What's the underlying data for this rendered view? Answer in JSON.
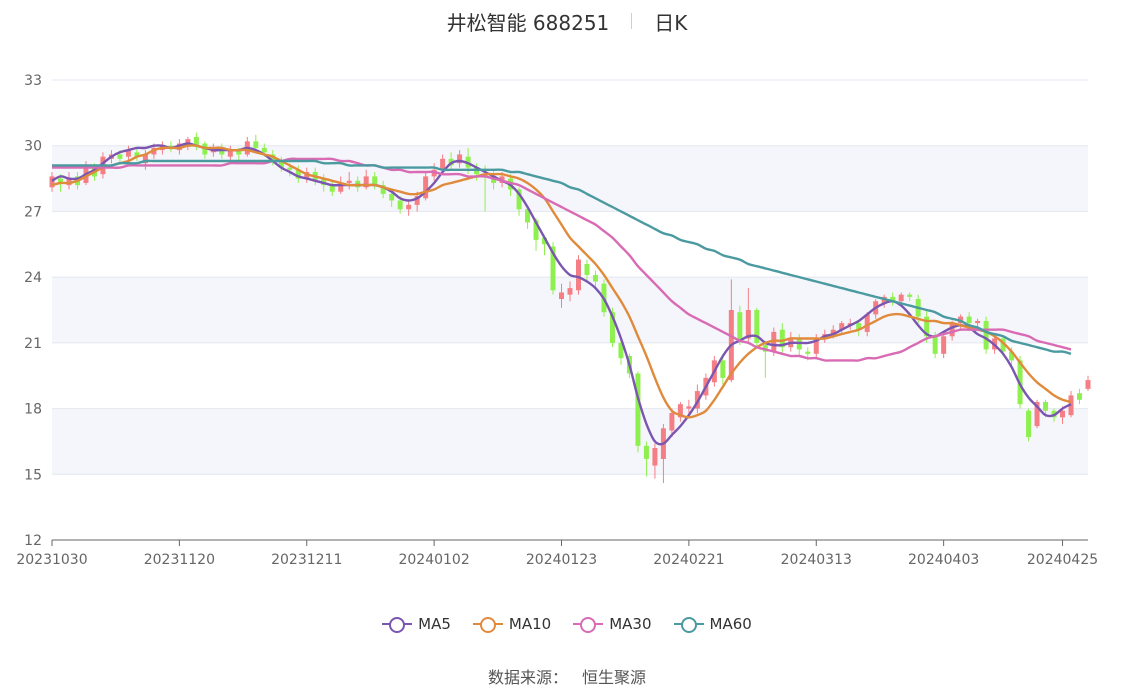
{
  "header": {
    "stock": "井松智能 688251",
    "period": "日K"
  },
  "source": {
    "label": "数据来源：",
    "value": "恒生聚源"
  },
  "colors": {
    "up": "#f57e85",
    "down": "#8ef04e",
    "grid": "#e4e7f0",
    "band": "#f5f6fb",
    "axis": "#555555"
  },
  "chart_data": {
    "type": "candlestick",
    "ylim": [
      12,
      33
    ],
    "yticks": [
      12,
      15,
      18,
      21,
      24,
      27,
      30,
      33
    ],
    "x_tick_labels": [
      "20231030",
      "20231120",
      "20231211",
      "20240102",
      "20240123",
      "20240221",
      "20240313",
      "20240403",
      "20240425"
    ],
    "x_tick_index": [
      0,
      15,
      30,
      45,
      60,
      75,
      90,
      105,
      119
    ],
    "candles": [
      [
        28.1,
        28.6,
        27.9,
        28.8
      ],
      [
        28.5,
        28.3,
        27.9,
        28.7
      ],
      [
        28.2,
        28.5,
        28.0,
        28.8
      ],
      [
        28.6,
        28.2,
        28.0,
        28.8
      ],
      [
        28.3,
        29.1,
        28.2,
        29.3
      ],
      [
        29.0,
        28.6,
        28.4,
        29.2
      ],
      [
        28.7,
        29.5,
        28.5,
        29.7
      ],
      [
        29.4,
        29.6,
        29.2,
        29.8
      ],
      [
        29.6,
        29.4,
        29.2,
        29.8
      ],
      [
        29.5,
        29.8,
        29.3,
        30.0
      ],
      [
        29.7,
        29.5,
        29.3,
        29.9
      ],
      [
        29.2,
        29.6,
        28.9,
        29.8
      ],
      [
        29.6,
        29.9,
        29.4,
        30.1
      ],
      [
        29.8,
        30.0,
        29.6,
        30.2
      ],
      [
        30.0,
        29.9,
        29.7,
        30.2
      ],
      [
        29.8,
        30.1,
        29.6,
        30.3
      ],
      [
        30.0,
        30.3,
        29.8,
        30.4
      ],
      [
        30.4,
        30.0,
        29.8,
        30.6
      ],
      [
        30.1,
        29.6,
        29.4,
        30.2
      ],
      [
        29.7,
        29.9,
        29.5,
        30.1
      ],
      [
        29.9,
        29.6,
        29.4,
        30.1
      ],
      [
        29.5,
        29.8,
        29.3,
        30.0
      ],
      [
        29.8,
        29.6,
        29.3,
        29.9
      ],
      [
        29.6,
        30.2,
        29.5,
        30.4
      ],
      [
        30.2,
        29.9,
        29.7,
        30.5
      ],
      [
        29.9,
        29.7,
        29.5,
        30.1
      ],
      [
        29.6,
        29.3,
        29.1,
        29.8
      ],
      [
        29.3,
        29.0,
        28.8,
        29.5
      ],
      [
        29.0,
        28.9,
        28.6,
        29.2
      ],
      [
        28.9,
        28.5,
        28.3,
        29.1
      ],
      [
        28.5,
        28.8,
        28.3,
        29.0
      ],
      [
        28.8,
        28.4,
        28.2,
        29.0
      ],
      [
        28.5,
        28.2,
        27.9,
        28.7
      ],
      [
        28.2,
        27.9,
        27.7,
        28.4
      ],
      [
        27.9,
        28.3,
        27.8,
        28.6
      ],
      [
        28.3,
        28.4,
        28.0,
        28.8
      ],
      [
        28.4,
        28.1,
        27.9,
        28.6
      ],
      [
        28.1,
        28.6,
        28.0,
        28.9
      ],
      [
        28.6,
        28.2,
        28.0,
        28.8
      ],
      [
        28.2,
        27.8,
        27.6,
        28.4
      ],
      [
        27.8,
        27.5,
        27.2,
        28.0
      ],
      [
        27.5,
        27.1,
        26.9,
        27.7
      ],
      [
        27.1,
        27.3,
        26.8,
        27.5
      ],
      [
        27.3,
        27.7,
        27.0,
        27.9
      ],
      [
        27.6,
        28.6,
        27.5,
        28.8
      ],
      [
        28.6,
        28.9,
        28.4,
        29.2
      ],
      [
        28.9,
        29.4,
        28.7,
        29.6
      ],
      [
        29.4,
        29.1,
        28.9,
        29.7
      ],
      [
        29.2,
        29.6,
        29.0,
        29.8
      ],
      [
        29.5,
        29.0,
        28.7,
        29.9
      ],
      [
        29.0,
        28.7,
        28.4,
        29.2
      ],
      [
        28.7,
        28.6,
        27.0,
        29.1
      ],
      [
        28.6,
        28.3,
        28.0,
        28.9
      ],
      [
        28.3,
        28.6,
        28.1,
        28.8
      ],
      [
        28.5,
        28.0,
        27.7,
        28.7
      ],
      [
        28.0,
        27.1,
        26.8,
        28.1
      ],
      [
        27.1,
        26.5,
        26.2,
        27.2
      ],
      [
        26.6,
        25.7,
        25.2,
        26.7
      ],
      [
        25.8,
        25.5,
        25.0,
        25.9
      ],
      [
        25.4,
        23.4,
        23.2,
        25.6
      ],
      [
        23.0,
        23.3,
        22.6,
        23.7
      ],
      [
        23.2,
        23.5,
        22.9,
        23.8
      ],
      [
        23.4,
        24.8,
        23.2,
        25.0
      ],
      [
        24.6,
        24.1,
        23.8,
        24.8
      ],
      [
        24.1,
        23.8,
        23.5,
        24.3
      ],
      [
        23.7,
        22.4,
        22.2,
        23.9
      ],
      [
        22.4,
        21.0,
        20.8,
        22.6
      ],
      [
        21.0,
        20.3,
        20.0,
        21.2
      ],
      [
        20.4,
        19.6,
        19.4,
        20.5
      ],
      [
        19.6,
        16.3,
        16.0,
        19.7
      ],
      [
        16.3,
        15.7,
        14.9,
        16.5
      ],
      [
        15.4,
        16.2,
        14.8,
        16.4
      ],
      [
        15.7,
        17.1,
        14.6,
        17.3
      ],
      [
        17.0,
        17.8,
        16.7,
        18.0
      ],
      [
        17.6,
        18.2,
        17.4,
        18.3
      ],
      [
        18.0,
        18.1,
        17.6,
        18.4
      ],
      [
        18.0,
        18.8,
        17.8,
        19.1
      ],
      [
        18.6,
        19.4,
        18.4,
        19.6
      ],
      [
        19.2,
        20.2,
        19.0,
        20.4
      ],
      [
        20.2,
        19.4,
        19.1,
        20.5
      ],
      [
        19.3,
        22.5,
        19.2,
        23.9
      ],
      [
        22.4,
        21.1,
        20.9,
        22.7
      ],
      [
        21.2,
        22.5,
        21.0,
        23.5
      ],
      [
        22.5,
        21.0,
        20.8,
        22.6
      ],
      [
        20.9,
        20.6,
        19.4,
        21.1
      ],
      [
        20.6,
        21.5,
        20.4,
        21.7
      ],
      [
        21.6,
        20.8,
        20.5,
        21.9
      ],
      [
        20.8,
        21.2,
        20.6,
        21.5
      ],
      [
        21.2,
        20.7,
        20.4,
        21.4
      ],
      [
        20.6,
        20.5,
        20.2,
        20.8
      ],
      [
        20.5,
        21.2,
        20.3,
        21.4
      ],
      [
        21.2,
        21.4,
        21.0,
        21.6
      ],
      [
        21.4,
        21.6,
        21.2,
        21.8
      ],
      [
        21.6,
        21.9,
        21.4,
        22.0
      ],
      [
        21.8,
        21.9,
        21.6,
        22.1
      ],
      [
        21.9,
        21.6,
        21.3,
        22.0
      ],
      [
        21.5,
        22.3,
        21.3,
        22.4
      ],
      [
        22.3,
        22.9,
        22.1,
        23.0
      ],
      [
        22.8,
        23.1,
        22.6,
        23.2
      ],
      [
        23.1,
        22.9,
        22.7,
        23.3
      ],
      [
        22.9,
        23.2,
        22.7,
        23.3
      ],
      [
        23.2,
        23.1,
        22.9,
        23.3
      ],
      [
        23.0,
        22.2,
        21.9,
        23.2
      ],
      [
        22.2,
        21.3,
        21.0,
        22.5
      ],
      [
        21.3,
        20.5,
        20.3,
        21.5
      ],
      [
        20.5,
        21.3,
        20.3,
        21.5
      ],
      [
        21.3,
        21.9,
        21.1,
        22.0
      ],
      [
        21.9,
        22.2,
        21.6,
        22.3
      ],
      [
        22.2,
        21.9,
        21.6,
        22.4
      ],
      [
        21.9,
        22.0,
        21.7,
        22.1
      ],
      [
        22.0,
        20.7,
        20.5,
        22.2
      ],
      [
        20.7,
        21.2,
        20.5,
        21.4
      ],
      [
        21.2,
        20.6,
        20.4,
        21.3
      ],
      [
        20.6,
        20.2,
        19.9,
        20.8
      ],
      [
        20.2,
        18.2,
        18.0,
        20.4
      ],
      [
        17.9,
        16.7,
        16.5,
        18.0
      ],
      [
        17.2,
        18.3,
        17.1,
        18.4
      ],
      [
        18.3,
        17.9,
        17.6,
        18.4
      ],
      [
        17.9,
        17.6,
        17.4,
        18.0
      ],
      [
        17.6,
        17.9,
        17.3,
        18.1
      ],
      [
        17.7,
        18.6,
        17.6,
        18.8
      ],
      [
        18.7,
        18.4,
        18.2,
        18.9
      ],
      [
        18.9,
        19.3,
        18.8,
        19.5
      ]
    ],
    "series": [
      {
        "name": "MA5",
        "color": "#7a56b0",
        "values": [
          28.4,
          28.6,
          28.5,
          28.5,
          28.7,
          28.9,
          29.2,
          29.5,
          29.7,
          29.8,
          29.9,
          29.9,
          30.0,
          30.0,
          29.9,
          30.0,
          30.1,
          30.0,
          29.9,
          29.8,
          29.8,
          29.8,
          29.8,
          29.9,
          29.8,
          29.6,
          29.3,
          29.0,
          28.8,
          28.6,
          28.5,
          28.4,
          28.3,
          28.2,
          28.2,
          28.2,
          28.2,
          28.2,
          28.2,
          28.1,
          27.9,
          27.6,
          27.5,
          27.6,
          27.9,
          28.3,
          28.8,
          29.2,
          29.3,
          29.2,
          29.0,
          28.8,
          28.6,
          28.4,
          28.2,
          27.8,
          27.2,
          26.5,
          25.8,
          25.1,
          24.5,
          24.1,
          24.0,
          23.8,
          23.5,
          23.0,
          22.2,
          21.2,
          20.0,
          18.5,
          17.3,
          16.5,
          16.4,
          16.8,
          17.2,
          17.7,
          18.3,
          19.0,
          19.7,
          20.4,
          20.9,
          21.1,
          21.3,
          21.3,
          21.0,
          20.9,
          20.9,
          21.0,
          21.0,
          21.0,
          21.1,
          21.3,
          21.4,
          21.6,
          21.8,
          22.0,
          22.3,
          22.6,
          22.8,
          22.9,
          22.7,
          22.3,
          21.8,
          21.4,
          21.3,
          21.5,
          21.7,
          21.8,
          21.7,
          21.4,
          21.2,
          20.9,
          20.5,
          19.9,
          19.1,
          18.5,
          18.1,
          17.7,
          17.7,
          18.0,
          18.2
        ]
      },
      {
        "name": "MA10",
        "color": "#e08a3c",
        "values": [
          28.2,
          28.3,
          28.3,
          28.4,
          28.6,
          28.8,
          29.0,
          29.1,
          29.2,
          29.3,
          29.5,
          29.6,
          29.8,
          29.9,
          29.9,
          29.9,
          30.0,
          30.0,
          29.9,
          29.9,
          29.9,
          29.8,
          29.8,
          29.8,
          29.7,
          29.6,
          29.5,
          29.3,
          29.1,
          28.9,
          28.7,
          28.6,
          28.5,
          28.4,
          28.3,
          28.2,
          28.2,
          28.2,
          28.2,
          28.1,
          28.0,
          27.9,
          27.8,
          27.8,
          27.9,
          28.0,
          28.2,
          28.3,
          28.4,
          28.5,
          28.6,
          28.7,
          28.7,
          28.7,
          28.6,
          28.5,
          28.3,
          28.0,
          27.6,
          27.0,
          26.4,
          25.8,
          25.4,
          25.0,
          24.6,
          24.1,
          23.5,
          22.9,
          22.2,
          21.3,
          20.4,
          19.4,
          18.5,
          17.9,
          17.7,
          17.6,
          17.7,
          17.9,
          18.4,
          19.0,
          19.6,
          20.1,
          20.5,
          20.8,
          21.0,
          21.1,
          21.1,
          21.2,
          21.2,
          21.2,
          21.2,
          21.2,
          21.3,
          21.4,
          21.5,
          21.6,
          21.8,
          22.0,
          22.2,
          22.3,
          22.3,
          22.2,
          22.1,
          22.0,
          22.0,
          21.9,
          21.9,
          21.8,
          21.7,
          21.6,
          21.5,
          21.3,
          21.0,
          20.6,
          20.1,
          19.6,
          19.2,
          18.9,
          18.6,
          18.4,
          18.3
        ]
      },
      {
        "name": "MA30",
        "color": "#d86bb4",
        "values": [
          29.0,
          29.0,
          29.0,
          29.0,
          29.0,
          29.0,
          29.0,
          29.0,
          29.0,
          29.1,
          29.1,
          29.1,
          29.1,
          29.1,
          29.1,
          29.1,
          29.1,
          29.1,
          29.1,
          29.1,
          29.1,
          29.2,
          29.2,
          29.2,
          29.2,
          29.2,
          29.3,
          29.3,
          29.4,
          29.4,
          29.4,
          29.4,
          29.4,
          29.4,
          29.3,
          29.3,
          29.2,
          29.1,
          29.1,
          29.0,
          28.9,
          28.9,
          28.8,
          28.8,
          28.8,
          28.8,
          28.7,
          28.7,
          28.7,
          28.6,
          28.6,
          28.6,
          28.5,
          28.4,
          28.3,
          28.2,
          28.0,
          27.8,
          27.6,
          27.4,
          27.2,
          27.0,
          26.8,
          26.6,
          26.4,
          26.1,
          25.8,
          25.4,
          25.0,
          24.5,
          24.1,
          23.7,
          23.3,
          22.9,
          22.6,
          22.3,
          22.1,
          21.9,
          21.7,
          21.5,
          21.3,
          21.1,
          21.0,
          20.8,
          20.7,
          20.6,
          20.5,
          20.4,
          20.4,
          20.3,
          20.3,
          20.2,
          20.2,
          20.2,
          20.2,
          20.2,
          20.3,
          20.3,
          20.4,
          20.5,
          20.6,
          20.8,
          21.0,
          21.2,
          21.3,
          21.4,
          21.5,
          21.6,
          21.6,
          21.6,
          21.6,
          21.6,
          21.6,
          21.5,
          21.4,
          21.3,
          21.1,
          21.0,
          20.9,
          20.8,
          20.7
        ]
      },
      {
        "name": "MA60",
        "color": "#4a9aa0",
        "values": [
          29.1,
          29.1,
          29.1,
          29.1,
          29.1,
          29.1,
          29.1,
          29.1,
          29.2,
          29.2,
          29.2,
          29.3,
          29.3,
          29.3,
          29.3,
          29.3,
          29.3,
          29.3,
          29.3,
          29.3,
          29.3,
          29.3,
          29.3,
          29.3,
          29.3,
          29.3,
          29.3,
          29.3,
          29.3,
          29.3,
          29.3,
          29.3,
          29.2,
          29.2,
          29.2,
          29.1,
          29.1,
          29.1,
          29.1,
          29.0,
          29.0,
          29.0,
          29.0,
          29.0,
          29.0,
          29.0,
          28.9,
          28.9,
          28.9,
          28.9,
          28.9,
          28.9,
          28.9,
          28.9,
          28.8,
          28.8,
          28.7,
          28.6,
          28.5,
          28.4,
          28.3,
          28.1,
          28.0,
          27.8,
          27.6,
          27.4,
          27.2,
          27.0,
          26.8,
          26.6,
          26.4,
          26.2,
          26.0,
          25.9,
          25.7,
          25.6,
          25.5,
          25.3,
          25.2,
          25.0,
          24.9,
          24.8,
          24.6,
          24.5,
          24.4,
          24.3,
          24.2,
          24.1,
          24.0,
          23.9,
          23.8,
          23.7,
          23.6,
          23.5,
          23.4,
          23.3,
          23.2,
          23.1,
          23.0,
          22.9,
          22.8,
          22.7,
          22.6,
          22.5,
          22.4,
          22.2,
          22.1,
          22.0,
          21.8,
          21.7,
          21.5,
          21.4,
          21.3,
          21.1,
          21.0,
          20.9,
          20.8,
          20.7,
          20.6,
          20.6,
          20.5
        ]
      }
    ]
  }
}
